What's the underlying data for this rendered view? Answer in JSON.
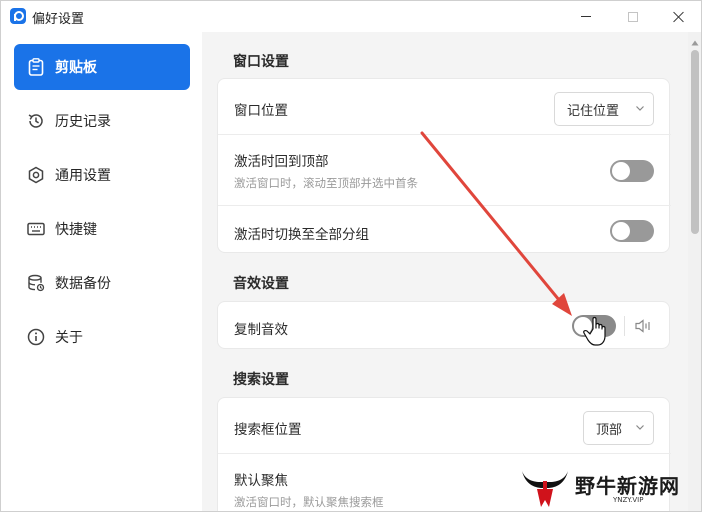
{
  "window": {
    "title": "偏好设置"
  },
  "sidebar": {
    "items": [
      {
        "label": "剪贴板",
        "icon": "clipboard-icon",
        "active": true
      },
      {
        "label": "历史记录",
        "icon": "history-icon",
        "active": false
      },
      {
        "label": "通用设置",
        "icon": "hexagon-settings-icon",
        "active": false
      },
      {
        "label": "快捷键",
        "icon": "keyboard-icon",
        "active": false
      },
      {
        "label": "数据备份",
        "icon": "database-icon",
        "active": false
      },
      {
        "label": "关于",
        "icon": "info-icon",
        "active": false
      }
    ]
  },
  "main": {
    "window_section": {
      "title": "窗口设置",
      "window_position": {
        "label": "窗口位置",
        "value": "记住位置"
      },
      "back_to_top": {
        "label": "激活时回到顶部",
        "description": "激活窗口时，滚动至顶部并选中首条",
        "enabled": false
      },
      "switch_all_group": {
        "label": "激活时切换至全部分组",
        "enabled": false
      }
    },
    "sound_section": {
      "title": "音效设置",
      "copy_sound": {
        "label": "复制音效",
        "enabled": false
      }
    },
    "search_section": {
      "title": "搜索设置",
      "search_position": {
        "label": "搜索框位置",
        "value": "顶部"
      },
      "default_focus": {
        "label": "默认聚焦",
        "description": "激活窗口时，默认聚焦搜索框"
      }
    }
  },
  "colors": {
    "accent": "#1a73e8",
    "annotation_arrow": "#e0463c",
    "main_bg": "#f4f4f4"
  },
  "watermark": {
    "text": "野牛新游网",
    "sub": "YNZY.VIP"
  }
}
